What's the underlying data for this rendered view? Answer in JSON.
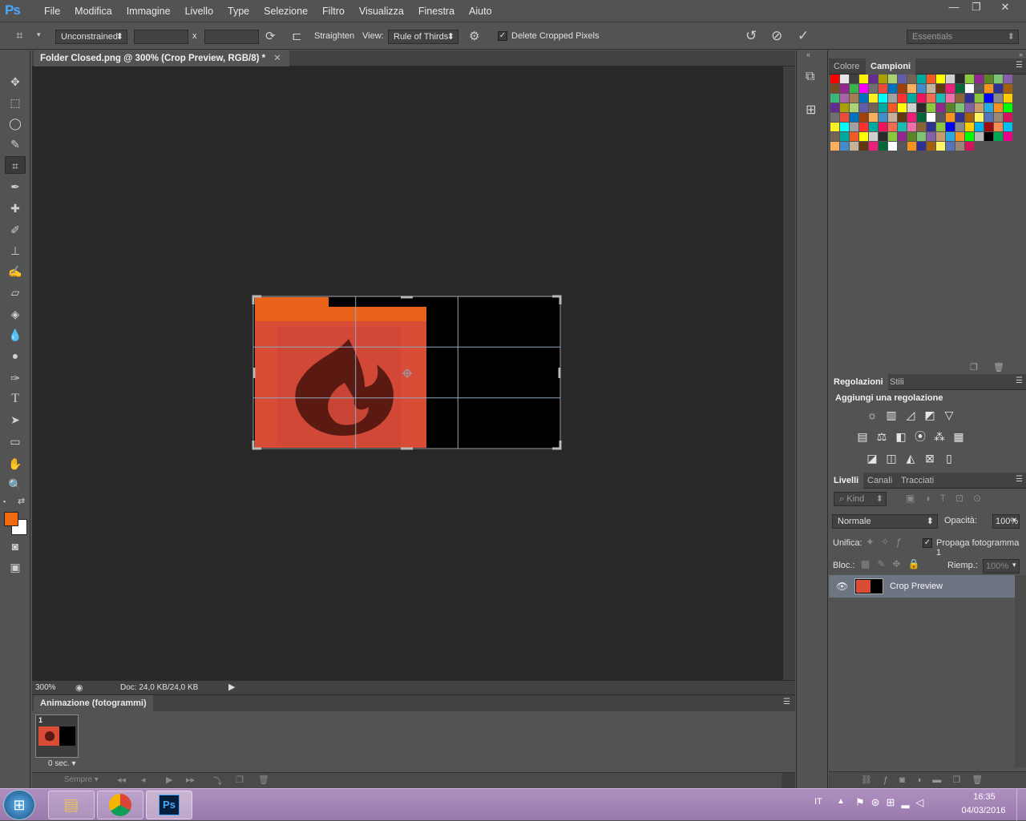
{
  "app": {
    "logo": "Ps"
  },
  "menu": [
    "File",
    "Modifica",
    "Immagine",
    "Livello",
    "Type",
    "Selezione",
    "Filtro",
    "Visualizza",
    "Finestra",
    "Aiuto"
  ],
  "window_controls": {
    "minimize": "—",
    "restore": "❐",
    "close": "✕"
  },
  "options_bar": {
    "ratio_select": "Unconstrained",
    "times": "x",
    "straighten": "Straighten",
    "view_label": "View:",
    "view_select": "Rule of Thirds",
    "delete_cropped": "Delete Cropped Pixels",
    "delete_cropped_checked": true,
    "workspace": "Essentials"
  },
  "document": {
    "tab_title": "Folder Closed.png @ 300% (Crop Preview, RGB/8) *",
    "zoom": "300%",
    "doc_info": "Doc: 24,0 KB/24,0 KB"
  },
  "animation": {
    "title": "Animazione (fotogrammi)",
    "frame_number": "1",
    "frame_delay": "0 sec.",
    "loop": "Sempre"
  },
  "swatches_panel": {
    "tabs": [
      "Colore",
      "Campioni"
    ],
    "active_tab": "Campioni"
  },
  "adjustments_panel": {
    "tabs": [
      "Regolazioni",
      "Stili"
    ],
    "heading": "Aggiungi una regolazione"
  },
  "layers_panel": {
    "tabs": [
      "Livelli",
      "Canali",
      "Tracciati"
    ],
    "filter_kind": "Kind",
    "blend_mode": "Normale",
    "opacity_label": "Opacità:",
    "opacity_value": "100%",
    "unify_label": "Unifica:",
    "propagate_label": "Propaga fotogramma 1",
    "lock_label": "Bloc.:",
    "fill_label": "Riemp.:",
    "fill_value": "100%",
    "layer_name": "Crop Preview"
  },
  "colors": {
    "foreground": "#f26a10",
    "background": "#ffffff",
    "accent_ps": "#4aa9ff"
  },
  "taskbar": {
    "language": "IT",
    "time": "16:35",
    "date": "04/03/2016"
  }
}
